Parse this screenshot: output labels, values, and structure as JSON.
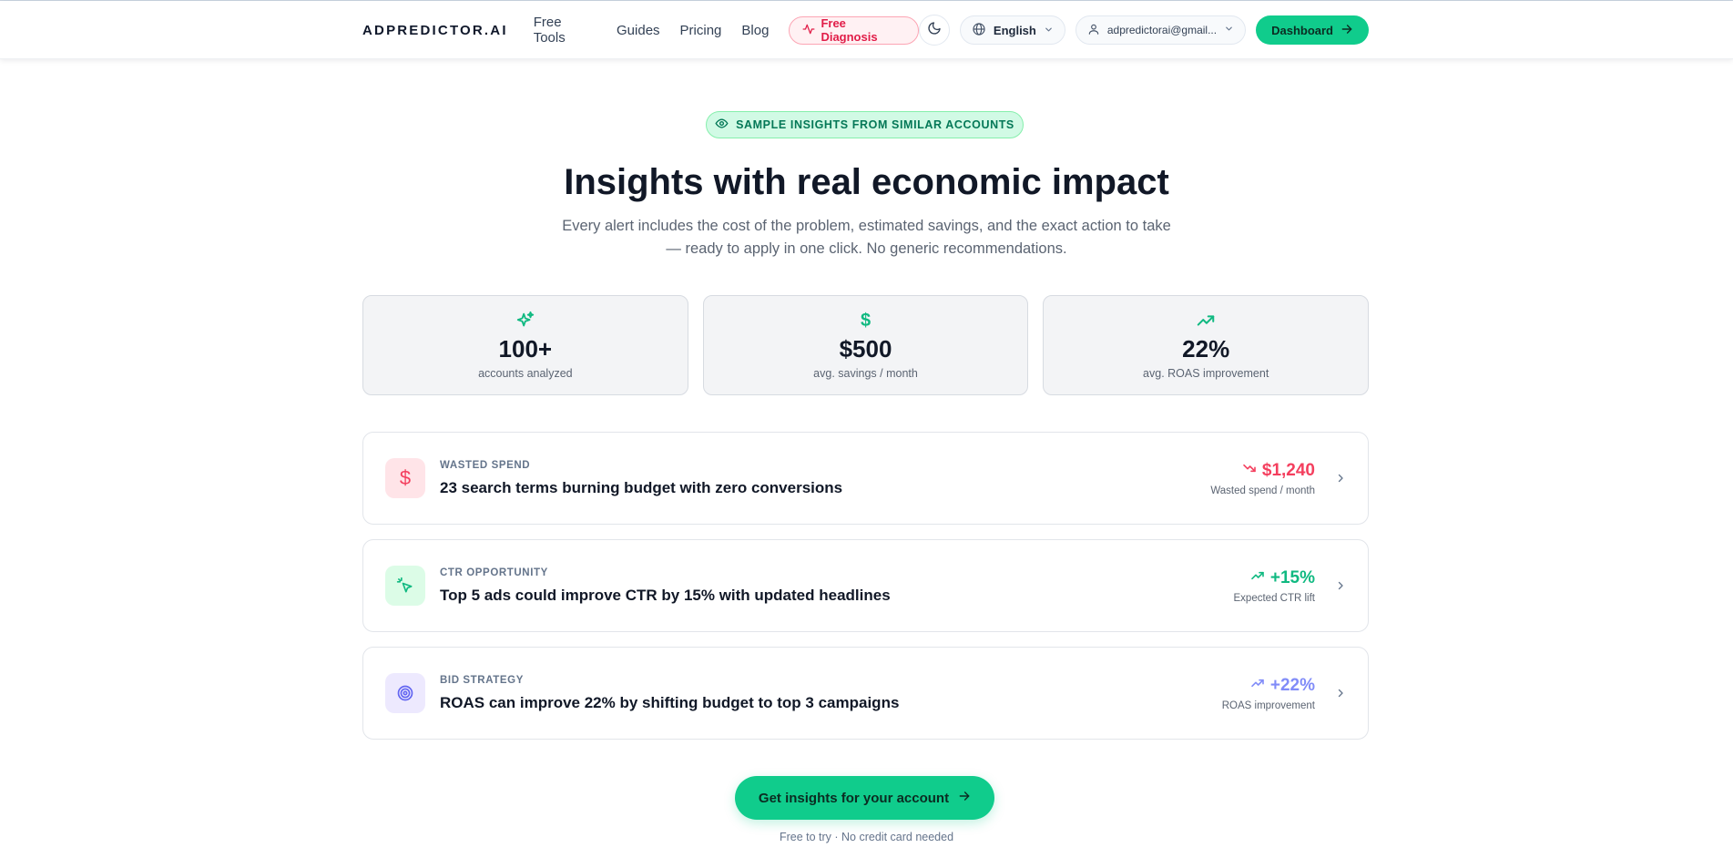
{
  "header": {
    "logo": "ADPREDICTOR.AI",
    "nav": [
      "Free Tools",
      "Guides",
      "Pricing",
      "Blog"
    ],
    "diagnosis_label": "Free Diagnosis",
    "language": "English",
    "account": "adpredictorai@gmail...",
    "dashboard_label": "Dashboard"
  },
  "hero": {
    "badge": "SAMPLE INSIGHTS FROM SIMILAR ACCOUNTS",
    "title": "Insights with real economic impact",
    "subtitle": "Every alert includes the cost of the problem, estimated savings, and the exact action to take — ready to apply in one click. No generic recommendations."
  },
  "stats": [
    {
      "icon": "sparkles-icon",
      "value": "100+",
      "label": "accounts analyzed"
    },
    {
      "icon": "dollar-icon",
      "value": "$500",
      "label": "avg. savings / month"
    },
    {
      "icon": "trending-up-icon",
      "value": "22%",
      "label": "avg. ROAS improvement"
    }
  ],
  "insights": [
    {
      "icon": "dollar-icon",
      "category": "WASTED SPEND",
      "title": "23 search terms burning budget with zero conversions",
      "metric": "$1,240",
      "metric_label": "Wasted spend / month",
      "color": "#f43f5e"
    },
    {
      "icon": "cursor-click-icon",
      "category": "CTR OPPORTUNITY",
      "title": "Top 5 ads could improve CTR by 15% with updated headlines",
      "metric": "+15%",
      "metric_label": "Expected CTR lift",
      "color": "#10b981"
    },
    {
      "icon": "target-icon",
      "category": "BID STRATEGY",
      "title": "ROAS can improve 22% by shifting budget to top 3 campaigns",
      "metric": "+22%",
      "metric_label": "ROAS improvement",
      "color": "#818cf8"
    }
  ],
  "cta": {
    "label": "Get insights for your account",
    "note": "Free to try · No credit card needed"
  },
  "colors": {
    "accent": "#10cc8c",
    "danger": "#f43f5e",
    "violet": "#818cf8"
  }
}
